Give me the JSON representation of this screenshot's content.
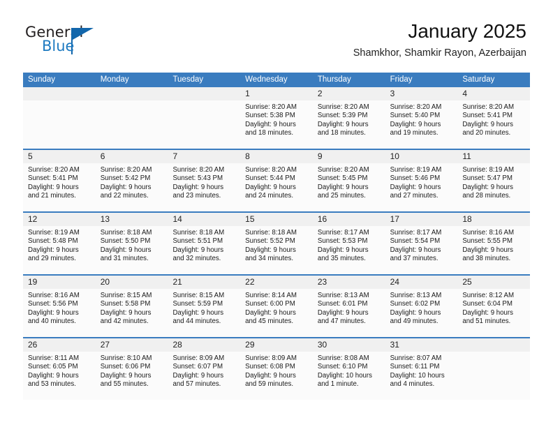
{
  "logo": {
    "word1": "General",
    "word2": "Blue",
    "triangle_color": "#1266ab",
    "blue_color": "#1f7bc1"
  },
  "header": {
    "title": "January 2025",
    "subtitle": "Shamkhor, Shamkir Rayon, Azerbaijan"
  },
  "theme": {
    "header_blue": "#3a7cbf",
    "date_strip_gray": "#f0f0f0",
    "cell_background": "#fbfbfb"
  },
  "weekdays": [
    "Sunday",
    "Monday",
    "Tuesday",
    "Wednesday",
    "Thursday",
    "Friday",
    "Saturday"
  ],
  "weeks": [
    {
      "days": [
        {
          "num": "",
          "sunrise": "",
          "sunset": "",
          "daylight1": "",
          "daylight2": ""
        },
        {
          "num": "",
          "sunrise": "",
          "sunset": "",
          "daylight1": "",
          "daylight2": ""
        },
        {
          "num": "",
          "sunrise": "",
          "sunset": "",
          "daylight1": "",
          "daylight2": ""
        },
        {
          "num": "1",
          "sunrise": "Sunrise: 8:20 AM",
          "sunset": "Sunset: 5:38 PM",
          "daylight1": "Daylight: 9 hours",
          "daylight2": "and 18 minutes."
        },
        {
          "num": "2",
          "sunrise": "Sunrise: 8:20 AM",
          "sunset": "Sunset: 5:39 PM",
          "daylight1": "Daylight: 9 hours",
          "daylight2": "and 18 minutes."
        },
        {
          "num": "3",
          "sunrise": "Sunrise: 8:20 AM",
          "sunset": "Sunset: 5:40 PM",
          "daylight1": "Daylight: 9 hours",
          "daylight2": "and 19 minutes."
        },
        {
          "num": "4",
          "sunrise": "Sunrise: 8:20 AM",
          "sunset": "Sunset: 5:41 PM",
          "daylight1": "Daylight: 9 hours",
          "daylight2": "and 20 minutes."
        }
      ]
    },
    {
      "days": [
        {
          "num": "5",
          "sunrise": "Sunrise: 8:20 AM",
          "sunset": "Sunset: 5:41 PM",
          "daylight1": "Daylight: 9 hours",
          "daylight2": "and 21 minutes."
        },
        {
          "num": "6",
          "sunrise": "Sunrise: 8:20 AM",
          "sunset": "Sunset: 5:42 PM",
          "daylight1": "Daylight: 9 hours",
          "daylight2": "and 22 minutes."
        },
        {
          "num": "7",
          "sunrise": "Sunrise: 8:20 AM",
          "sunset": "Sunset: 5:43 PM",
          "daylight1": "Daylight: 9 hours",
          "daylight2": "and 23 minutes."
        },
        {
          "num": "8",
          "sunrise": "Sunrise: 8:20 AM",
          "sunset": "Sunset: 5:44 PM",
          "daylight1": "Daylight: 9 hours",
          "daylight2": "and 24 minutes."
        },
        {
          "num": "9",
          "sunrise": "Sunrise: 8:20 AM",
          "sunset": "Sunset: 5:45 PM",
          "daylight1": "Daylight: 9 hours",
          "daylight2": "and 25 minutes."
        },
        {
          "num": "10",
          "sunrise": "Sunrise: 8:19 AM",
          "sunset": "Sunset: 5:46 PM",
          "daylight1": "Daylight: 9 hours",
          "daylight2": "and 27 minutes."
        },
        {
          "num": "11",
          "sunrise": "Sunrise: 8:19 AM",
          "sunset": "Sunset: 5:47 PM",
          "daylight1": "Daylight: 9 hours",
          "daylight2": "and 28 minutes."
        }
      ]
    },
    {
      "days": [
        {
          "num": "12",
          "sunrise": "Sunrise: 8:19 AM",
          "sunset": "Sunset: 5:48 PM",
          "daylight1": "Daylight: 9 hours",
          "daylight2": "and 29 minutes."
        },
        {
          "num": "13",
          "sunrise": "Sunrise: 8:18 AM",
          "sunset": "Sunset: 5:50 PM",
          "daylight1": "Daylight: 9 hours",
          "daylight2": "and 31 minutes."
        },
        {
          "num": "14",
          "sunrise": "Sunrise: 8:18 AM",
          "sunset": "Sunset: 5:51 PM",
          "daylight1": "Daylight: 9 hours",
          "daylight2": "and 32 minutes."
        },
        {
          "num": "15",
          "sunrise": "Sunrise: 8:18 AM",
          "sunset": "Sunset: 5:52 PM",
          "daylight1": "Daylight: 9 hours",
          "daylight2": "and 34 minutes."
        },
        {
          "num": "16",
          "sunrise": "Sunrise: 8:17 AM",
          "sunset": "Sunset: 5:53 PM",
          "daylight1": "Daylight: 9 hours",
          "daylight2": "and 35 minutes."
        },
        {
          "num": "17",
          "sunrise": "Sunrise: 8:17 AM",
          "sunset": "Sunset: 5:54 PM",
          "daylight1": "Daylight: 9 hours",
          "daylight2": "and 37 minutes."
        },
        {
          "num": "18",
          "sunrise": "Sunrise: 8:16 AM",
          "sunset": "Sunset: 5:55 PM",
          "daylight1": "Daylight: 9 hours",
          "daylight2": "and 38 minutes."
        }
      ]
    },
    {
      "days": [
        {
          "num": "19",
          "sunrise": "Sunrise: 8:16 AM",
          "sunset": "Sunset: 5:56 PM",
          "daylight1": "Daylight: 9 hours",
          "daylight2": "and 40 minutes."
        },
        {
          "num": "20",
          "sunrise": "Sunrise: 8:15 AM",
          "sunset": "Sunset: 5:58 PM",
          "daylight1": "Daylight: 9 hours",
          "daylight2": "and 42 minutes."
        },
        {
          "num": "21",
          "sunrise": "Sunrise: 8:15 AM",
          "sunset": "Sunset: 5:59 PM",
          "daylight1": "Daylight: 9 hours",
          "daylight2": "and 44 minutes."
        },
        {
          "num": "22",
          "sunrise": "Sunrise: 8:14 AM",
          "sunset": "Sunset: 6:00 PM",
          "daylight1": "Daylight: 9 hours",
          "daylight2": "and 45 minutes."
        },
        {
          "num": "23",
          "sunrise": "Sunrise: 8:13 AM",
          "sunset": "Sunset: 6:01 PM",
          "daylight1": "Daylight: 9 hours",
          "daylight2": "and 47 minutes."
        },
        {
          "num": "24",
          "sunrise": "Sunrise: 8:13 AM",
          "sunset": "Sunset: 6:02 PM",
          "daylight1": "Daylight: 9 hours",
          "daylight2": "and 49 minutes."
        },
        {
          "num": "25",
          "sunrise": "Sunrise: 8:12 AM",
          "sunset": "Sunset: 6:04 PM",
          "daylight1": "Daylight: 9 hours",
          "daylight2": "and 51 minutes."
        }
      ]
    },
    {
      "days": [
        {
          "num": "26",
          "sunrise": "Sunrise: 8:11 AM",
          "sunset": "Sunset: 6:05 PM",
          "daylight1": "Daylight: 9 hours",
          "daylight2": "and 53 minutes."
        },
        {
          "num": "27",
          "sunrise": "Sunrise: 8:10 AM",
          "sunset": "Sunset: 6:06 PM",
          "daylight1": "Daylight: 9 hours",
          "daylight2": "and 55 minutes."
        },
        {
          "num": "28",
          "sunrise": "Sunrise: 8:09 AM",
          "sunset": "Sunset: 6:07 PM",
          "daylight1": "Daylight: 9 hours",
          "daylight2": "and 57 minutes."
        },
        {
          "num": "29",
          "sunrise": "Sunrise: 8:09 AM",
          "sunset": "Sunset: 6:08 PM",
          "daylight1": "Daylight: 9 hours",
          "daylight2": "and 59 minutes."
        },
        {
          "num": "30",
          "sunrise": "Sunrise: 8:08 AM",
          "sunset": "Sunset: 6:10 PM",
          "daylight1": "Daylight: 10 hours",
          "daylight2": "and 1 minute."
        },
        {
          "num": "31",
          "sunrise": "Sunrise: 8:07 AM",
          "sunset": "Sunset: 6:11 PM",
          "daylight1": "Daylight: 10 hours",
          "daylight2": "and 4 minutes."
        },
        {
          "num": "",
          "sunrise": "",
          "sunset": "",
          "daylight1": "",
          "daylight2": ""
        }
      ]
    }
  ]
}
